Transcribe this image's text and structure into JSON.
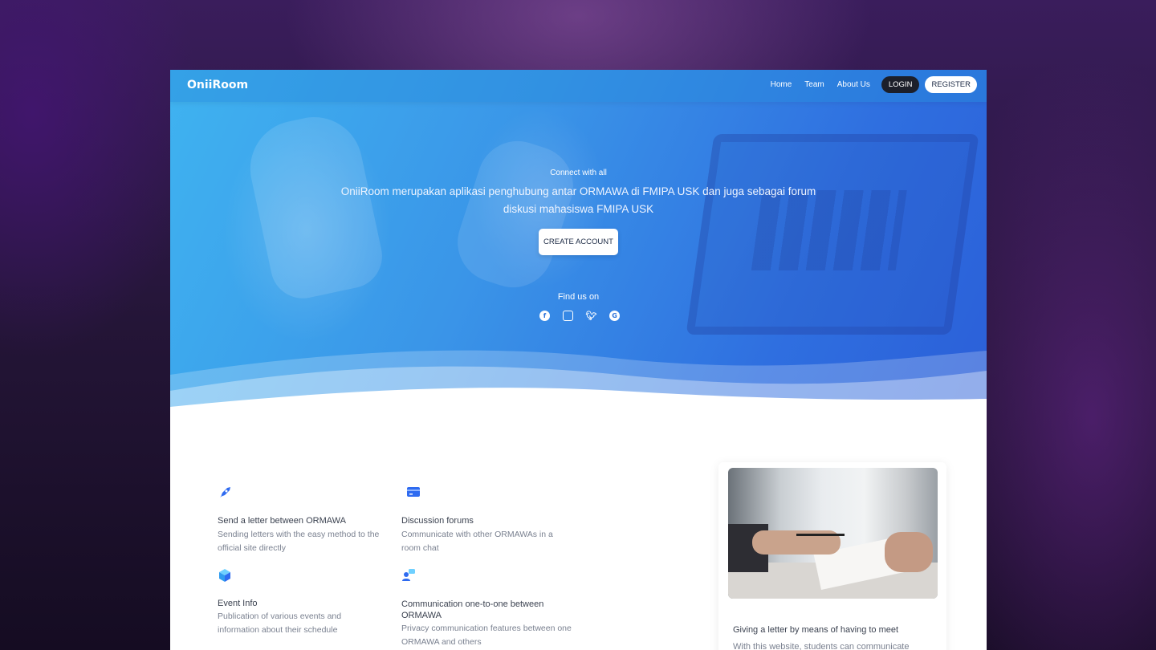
{
  "brand": "OniiRoom",
  "nav": {
    "links": [
      "Home",
      "Team",
      "About Us"
    ],
    "login": "LOGIN",
    "register": "REGISTER"
  },
  "hero": {
    "tagline": "Connect with all",
    "description": "OniiRoom merupakan aplikasi penghubung antar ORMAWA di FMIPA USK dan juga sebagai forum diskusi mahasiswa FMIPA USK",
    "cta": "CREATE ACCOUNT",
    "find_us": "Find us on",
    "socials": [
      "facebook-icon",
      "instagram-icon",
      "twitter-icon",
      "google-plus-icon"
    ]
  },
  "features": [
    {
      "icon": "rocket-icon",
      "title": "Send a letter between ORMAWA",
      "desc": "Sending letters with the easy method to the official site directly"
    },
    {
      "icon": "credit-card-icon",
      "title": "Discussion forums",
      "desc": "Communicate with other ORMAWAs in a room chat"
    },
    {
      "icon": "cube-icon",
      "title": "Event Info",
      "desc": "Publication of various events and information about their schedule"
    },
    {
      "icon": "user-chat-icon",
      "title": "Communication one-to-one between ORMAWA",
      "desc": "Privacy communication features between one ORMAWA and others"
    }
  ],
  "card": {
    "title": "Giving a letter by means of having to meet",
    "desc": "With this website, students can communicate"
  },
  "colors": {
    "hero_start": "#3fb3f0",
    "hero_end": "#2b5fd8",
    "icon_blue": "#2f6bf0",
    "login_bg": "#1c1f2a"
  }
}
